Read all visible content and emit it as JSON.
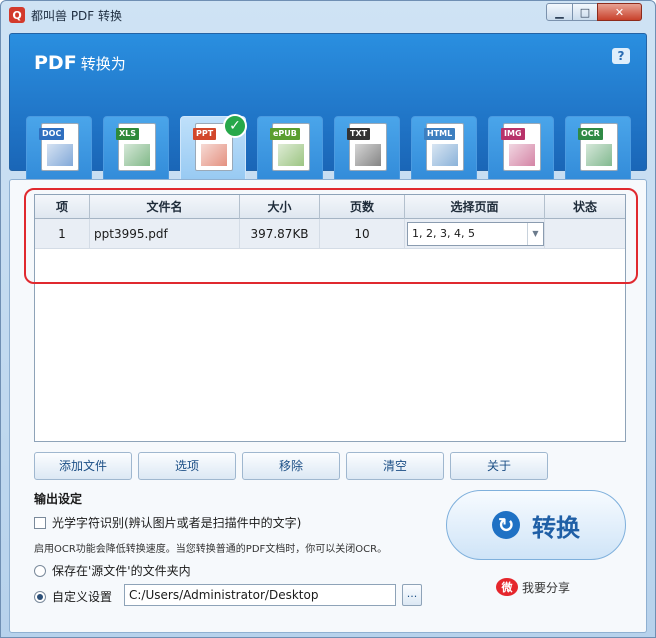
{
  "window": {
    "title": "都叫兽 PDF 转换",
    "logo": "Q"
  },
  "header": {
    "title": "PDF",
    "subtitle": "转换为",
    "formats": [
      {
        "tag": "DOC",
        "label": "Word",
        "tag_color": "#2f6fbf",
        "selected": false
      },
      {
        "tag": "XLS",
        "label": "Excel",
        "tag_color": "#2e8a3a",
        "selected": false
      },
      {
        "tag": "PPT",
        "label": "PowerPoint",
        "tag_color": "#d2472b",
        "selected": true
      },
      {
        "tag": "ePUB",
        "label": "EPUB",
        "tag_color": "#5a9e2f",
        "selected": false
      },
      {
        "tag": "TXT",
        "label": "Text",
        "tag_color": "#333333",
        "selected": false
      },
      {
        "tag": "HTML",
        "label": "HTML",
        "tag_color": "#3d7fc0",
        "selected": false
      },
      {
        "tag": "IMG",
        "label": "Image",
        "tag_color": "#b8336a",
        "selected": false
      },
      {
        "tag": "OCR",
        "label": "OCR",
        "tag_color": "#2f8a45",
        "selected": false
      }
    ]
  },
  "table": {
    "columns": [
      "项",
      "文件名",
      "大小",
      "页数",
      "选择页面",
      "状态"
    ],
    "rows": [
      {
        "index": "1",
        "filename": "ppt3995.pdf",
        "size": "397.87KB",
        "pages": "10",
        "page_selection": "1, 2, 3, 4, 5",
        "status": ""
      }
    ]
  },
  "actions": {
    "add": "添加文件",
    "options": "选项",
    "remove": "移除",
    "clear": "清空",
    "about": "关于"
  },
  "output": {
    "title": "输出设定",
    "ocr_label": "光学字符识别(辨认图片或者是扫描件中的文字)",
    "ocr_hint": "启用OCR功能会降低转换速度。当您转换普通的PDF文档时，你可以关闭OCR。",
    "save_source_label": "保存在'源文件'的文件夹内",
    "custom_label": "自定义设置",
    "custom_path": "C:/Users/Administrator/Desktop",
    "browse": "..."
  },
  "convert": {
    "label": "转换"
  },
  "share": {
    "label": "我要分享"
  }
}
